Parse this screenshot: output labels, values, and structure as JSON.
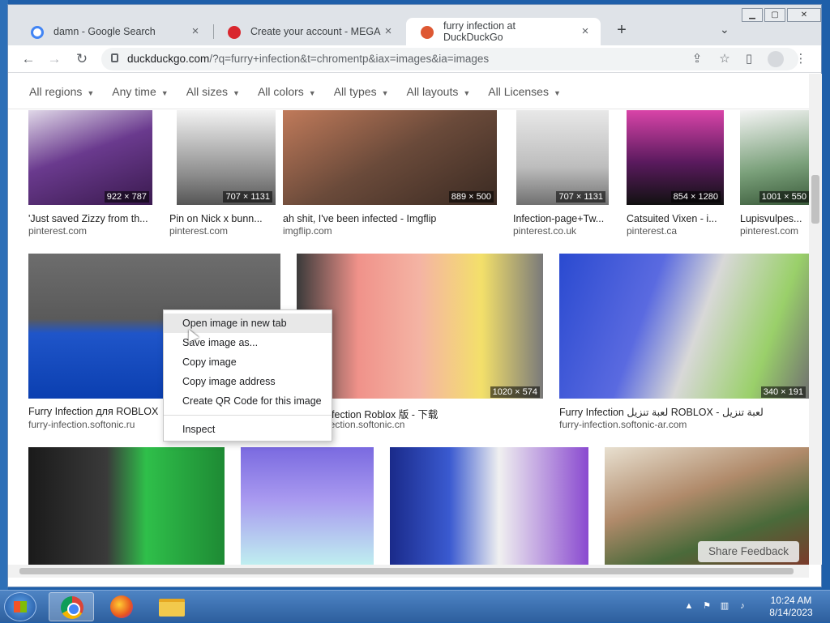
{
  "window_controls": {
    "minimize": "▁",
    "maximize": "▢",
    "close": "✕"
  },
  "tabs": [
    {
      "title": "damn - Google Search",
      "favicon": "google-g-icon",
      "color": "#4285f4"
    },
    {
      "title": "Create your account - MEGA",
      "favicon": "mega-icon",
      "color": "#d9272e"
    },
    {
      "title": "furry infection at DuckDuckGo",
      "favicon": "duckduckgo-icon",
      "color": "#de5833",
      "active": true
    }
  ],
  "toolbar": {
    "url_domain": "duckduckgo.com",
    "url_path": "/?q=furry+infection&t=chromentp&iax=images&ia=images",
    "back": "←",
    "forward": "→",
    "reload": "↻",
    "share": "⇪",
    "star": "☆",
    "sidebar": "▯",
    "menu": "⋮"
  },
  "filters": [
    "All regions",
    "Any time",
    "All sizes",
    "All colors",
    "All types",
    "All layouts",
    "All Licenses"
  ],
  "results_row1": [
    {
      "dims": "922 × 787",
      "title": "'Just saved Zizzy from th...",
      "source": "pinterest.com",
      "color": "#5a2a7a"
    },
    {
      "dims": "707 × 1131",
      "title": "Pin on Nick x bunn...",
      "source": "pinterest.com",
      "color": "#9a9a9a"
    },
    {
      "dims": "889 × 500",
      "title": "ah shit, I've been infected - Imgflip",
      "source": "imgflip.com",
      "color": "#7a5a4a"
    },
    {
      "dims": "707 × 1131",
      "title": "Infection-page+Tw...",
      "source": "pinterest.co.uk",
      "color": "#c8c8c8"
    },
    {
      "dims": "854 × 1280",
      "title": "Catsuited Vixen - i...",
      "source": "pinterest.ca",
      "color": "#c0338e"
    },
    {
      "dims": "1001 × 550",
      "title": "Lupisvulpes...",
      "source": "pinterest.com",
      "color": "#5b8a5b"
    }
  ],
  "results_row2": [
    {
      "dims": "",
      "title": "Furry Infection для ROBLOX",
      "source": "furry-infection.softonic.ru",
      "color": "#2a56c6"
    },
    {
      "dims": "1020 × 574",
      "title": "Furry Infection Roblox 版 - 下载",
      "source": "furry-infection.softonic.cn",
      "color": "#e89a8a"
    },
    {
      "dims": "340 × 191",
      "title": "Furry Infection لعبة تنزيل ROBLOX - لعبة تنزيل",
      "source": "furry-infection.softonic-ar.com",
      "color": "#4a6ad0"
    }
  ],
  "results_row3": [
    {
      "color": "#2fbf4a"
    },
    {
      "color": "#8a7ae0"
    },
    {
      "color": "#3a5ad0"
    },
    {
      "color": "#b0a08a"
    }
  ],
  "context_menu": [
    "Open image in new tab",
    "Save image as...",
    "Copy image",
    "Copy image address",
    "Create QR Code for this image",
    "Inspect"
  ],
  "share_feedback": "Share Feedback",
  "clock": {
    "time": "10:24 AM",
    "date": "8/14/2023"
  }
}
